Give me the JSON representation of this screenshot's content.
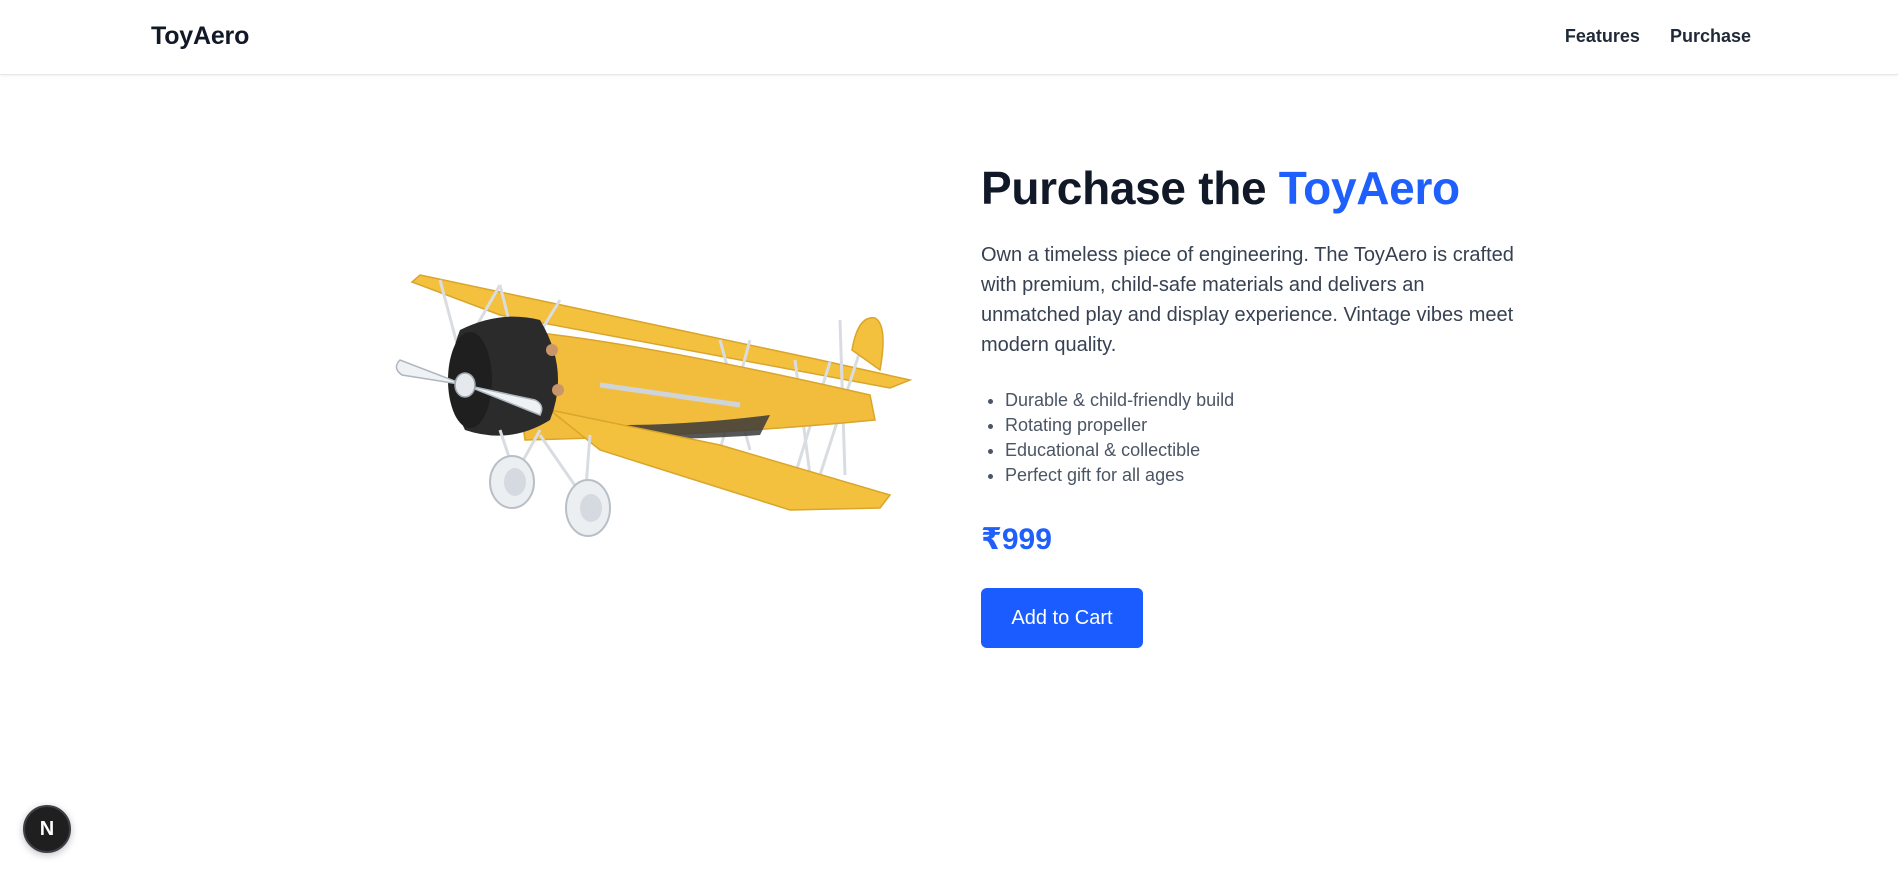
{
  "nav": {
    "brand": "ToyAero",
    "links": [
      "Features",
      "Purchase"
    ]
  },
  "hero": {
    "title_prefix": "Purchase the ",
    "title_accent": "ToyAero",
    "description": "Own a timeless piece of engineering. The ToyAero is crafted with premium, child-safe materials and delivers an unmatched play and display experience. Vintage vibes meet modern quality.",
    "features": [
      "Durable & child-friendly build",
      "Rotating propeller",
      "Educational & collectible",
      "Perfect gift for all ages"
    ],
    "price": "₹999",
    "cta_label": "Add to Cart"
  },
  "dev_badge": {
    "letter": "N"
  },
  "colors": {
    "accent": "#1f5ffb",
    "button": "#1a5cff",
    "plane_body": "#f2bd3c",
    "engine": "#2b2b2b"
  },
  "icons": {
    "product_image": "biplane-illustration",
    "dev_badge": "nextjs-logo-icon"
  }
}
